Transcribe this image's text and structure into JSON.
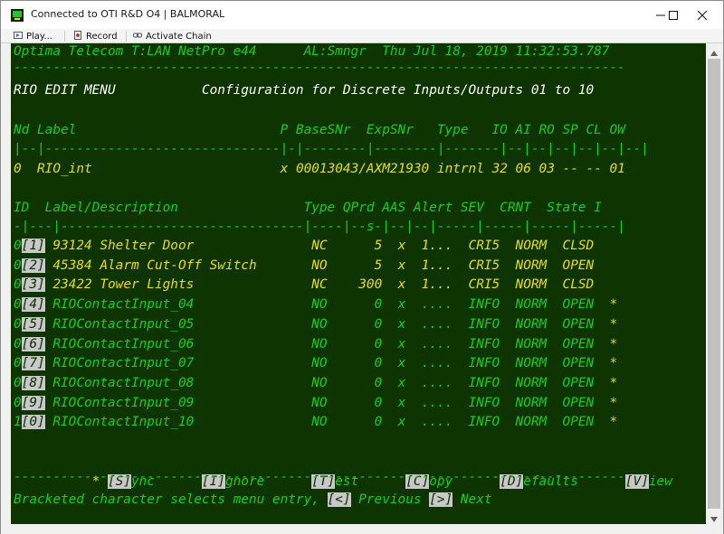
{
  "window": {
    "title": "Connected to OTI R&D O4 | BALMORAL",
    "icons": [
      "app-icon",
      "minimize-icon",
      "maximize-icon",
      "close-icon"
    ]
  },
  "toolbar": {
    "play_label": "Play...",
    "record_label": "Record",
    "activate_chain_label": "Activate Chain"
  },
  "colors": {
    "terminal_bg": "#0e3402",
    "green_text": "#1ecb1e",
    "yellow_text": "#e8dc1c",
    "highlight_bg": "#c8c8c8"
  },
  "terminal": {
    "header": {
      "system": "Optima Telecom T:LAN NetPro e44",
      "alarm": "AL:Smngr",
      "datetime": "Thu Jul 18, 2019 11:32:53.787"
    },
    "separator": "------------------------------------------------------------------------------",
    "menu_title": "RIO EDIT MENU",
    "config_title": "Configuration for Discrete Inputs/Outputs 01 to 10",
    "node_header": "Nd Label                          P BaseSNr  ExpSNr   Type   IO AI RO SP CL OW",
    "node_divider": "|--|------------------------------|-|--------|--------|-------|--|--|--|--|--|--|",
    "node_row": {
      "nd": "0",
      "label": "RIO_int",
      "p": "x",
      "base_exp": "00013043/AXM21930",
      "type": "intrnl",
      "counts": "32 06 03 -- -- 01"
    },
    "table_header": "ID  Label/Description                Type QPrd AAS Alert SEV  CRNT  State I",
    "table_divider": "-|---|-------------------------------|----|--s-|--|--|-----|-----|-----|-----|",
    "rows": [
      {
        "pre": "0",
        "key": "[1]",
        "label": "93124 Shelter Door",
        "type": "NC",
        "qprd": "5",
        "aas": "x",
        "alert": "1...",
        "sev": "CRI5",
        "crnt": "NORM",
        "state": "CLSD",
        "flag": "",
        "active": true
      },
      {
        "pre": "0",
        "key": "[2]",
        "label": "45384 Alarm Cut-Off Switch",
        "type": "NO",
        "qprd": "5",
        "aas": "x",
        "alert": "1...",
        "sev": "CRI5",
        "crnt": "NORM",
        "state": "OPEN",
        "flag": "",
        "active": true
      },
      {
        "pre": "0",
        "key": "[3]",
        "label": "23422 Tower Lights",
        "type": "NC",
        "qprd": "300",
        "aas": "x",
        "alert": "1...",
        "sev": "CRI5",
        "crnt": "NORM",
        "state": "CLSD",
        "flag": "",
        "active": true
      },
      {
        "pre": "0",
        "key": "[4]",
        "label": "RIOContactInput_04",
        "type": "NO",
        "qprd": "0",
        "aas": "x",
        "alert": "....",
        "sev": "INFO",
        "crnt": "NORM",
        "state": "OPEN",
        "flag": "*",
        "active": false
      },
      {
        "pre": "0",
        "key": "[5]",
        "label": "RIOContactInput_05",
        "type": "NO",
        "qprd": "0",
        "aas": "x",
        "alert": "....",
        "sev": "INFO",
        "crnt": "NORM",
        "state": "OPEN",
        "flag": "*",
        "active": false
      },
      {
        "pre": "0",
        "key": "[6]",
        "label": "RIOContactInput_06",
        "type": "NO",
        "qprd": "0",
        "aas": "x",
        "alert": "....",
        "sev": "INFO",
        "crnt": "NORM",
        "state": "OPEN",
        "flag": "*",
        "active": false
      },
      {
        "pre": "0",
        "key": "[7]",
        "label": "RIOContactInput_07",
        "type": "NO",
        "qprd": "0",
        "aas": "x",
        "alert": "....",
        "sev": "INFO",
        "crnt": "NORM",
        "state": "OPEN",
        "flag": "*",
        "active": false
      },
      {
        "pre": "0",
        "key": "[8]",
        "label": "RIOContactInput_08",
        "type": "NO",
        "qprd": "0",
        "aas": "x",
        "alert": "....",
        "sev": "INFO",
        "crnt": "NORM",
        "state": "OPEN",
        "flag": "*",
        "active": false
      },
      {
        "pre": "0",
        "key": "[9]",
        "label": "RIOContactInput_09",
        "type": "NO",
        "qprd": "0",
        "aas": "x",
        "alert": "....",
        "sev": "INFO",
        "crnt": "NORM",
        "state": "OPEN",
        "flag": "*",
        "active": false
      },
      {
        "pre": "1",
        "key": "[0]",
        "label": "RIOContactInput_10",
        "type": "NO",
        "qprd": "0",
        "aas": "x",
        "alert": "....",
        "sev": "INFO",
        "crnt": "NORM",
        "state": "OPEN",
        "flag": "*",
        "active": false
      }
    ],
    "menu": [
      {
        "prefix": "* ",
        "key": "[S]",
        "rest": "ync"
      },
      {
        "prefix": "",
        "key": "[I]",
        "rest": "gnore"
      },
      {
        "prefix": "",
        "key": "[T]",
        "rest": "est"
      },
      {
        "prefix": "",
        "key": "[C]",
        "rest": "opy"
      },
      {
        "prefix": "",
        "key": "[D]",
        "rest": "efaults"
      },
      {
        "prefix": "",
        "key": "[V]",
        "rest": "iew"
      }
    ],
    "footer": {
      "prompt": "Bracketed character selects menu entry, ",
      "prev_key": "[<]",
      "prev_label": " Previous ",
      "next_key": "[>]",
      "next_label": " Next"
    }
  }
}
